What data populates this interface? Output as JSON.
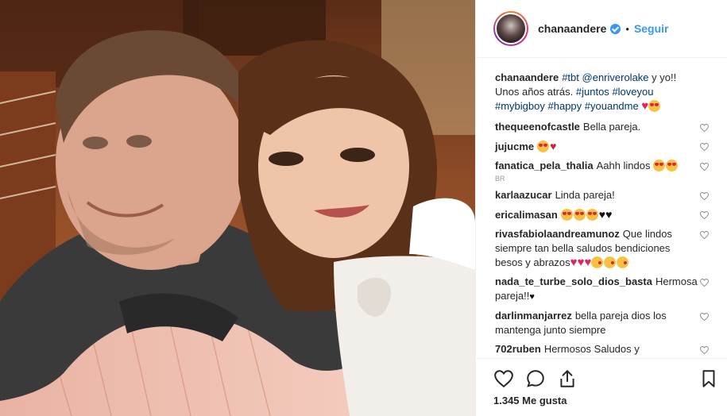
{
  "post": {
    "author": "chanaandere",
    "verified": true,
    "separator": "•",
    "follow_label": "Seguir",
    "caption": {
      "user": "chanaandere",
      "parts": [
        {
          "t": "#tbt",
          "tag": true
        },
        {
          "t": " ",
          "tag": false
        },
        {
          "t": "@enriverolake",
          "tag": true
        },
        {
          "t": " y yo!! Unos años atrás. ",
          "tag": false
        },
        {
          "t": "#juntos",
          "tag": true
        },
        {
          "t": " ",
          "tag": false
        },
        {
          "t": "#loveyou",
          "tag": true
        },
        {
          "t": " ",
          "tag": false
        },
        {
          "t": "#mybigboy",
          "tag": true
        },
        {
          "t": " ",
          "tag": false
        },
        {
          "t": "#happy",
          "tag": true
        },
        {
          "t": " ",
          "tag": false
        },
        {
          "t": "#youandme",
          "tag": true
        },
        {
          "t": " ",
          "tag": false
        }
      ],
      "emoji": [
        "red-heart",
        "heart-eyes"
      ]
    },
    "likes_text": "1.345 Me gusta"
  },
  "comments": [
    {
      "user": "thequeenofcastle",
      "text": "Bella pareja.",
      "emoji": []
    },
    {
      "user": "jujucme",
      "text": "",
      "emoji": [
        "heart-eyes",
        "broken-heart"
      ]
    },
    {
      "user": "fanatica_pela_thalia",
      "text": "Aahh lindos ",
      "emoji": [
        "heart-eyes",
        "heart-eyes"
      ],
      "sub": "BR"
    },
    {
      "user": "karlaazucar",
      "text": "Linda pareja!",
      "emoji": []
    },
    {
      "user": "ericalimasan",
      "text": "",
      "emoji": [
        "heart-eyes",
        "heart-eyes",
        "heart-eyes",
        "black-heart",
        "black-heart"
      ]
    },
    {
      "user": "rivasfabiolaandreamunoz",
      "text": "Que lindos siempre tan bella saludos bendiciones besos y abrazos",
      "emoji": [
        "red-heart",
        "red-heart",
        "red-heart",
        "kissing-face",
        "kissing-face",
        "kissing-face"
      ]
    },
    {
      "user": "nada_te_turbe_solo_dios_basta",
      "text": "Hermosa pareja!!",
      "emoji": [
        "black-heart-small"
      ]
    },
    {
      "user": "darlinmanjarrez",
      "text": "bella pareja dios los mantenga junto siempre",
      "emoji": []
    },
    {
      "user": "702ruben",
      "text": "Hermosos Saludos y bendiciones",
      "emoji": []
    }
  ],
  "icons": {
    "like": "heart-outline-icon",
    "comment": "speech-bubble-icon",
    "share": "share-arrow-icon",
    "save": "bookmark-icon",
    "comment_like": "small-heart-outline-icon"
  },
  "colors": {
    "link": "#003569",
    "follow": "#3897f0",
    "verified": "#3897f0",
    "text": "#262626",
    "muted": "#999999"
  }
}
